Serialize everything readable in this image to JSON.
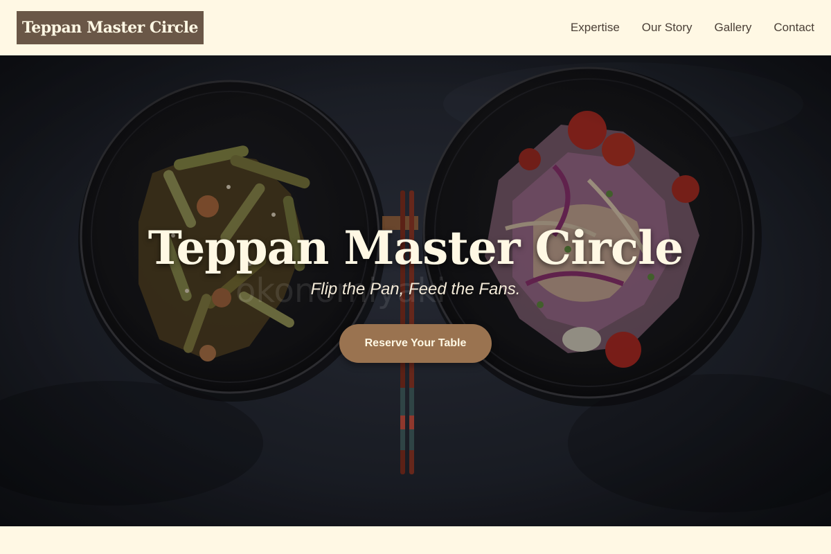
{
  "header": {
    "logo_text": "Teppan Master Circle",
    "nav": [
      {
        "label": "Expertise"
      },
      {
        "label": "Our Story"
      },
      {
        "label": "Gallery"
      },
      {
        "label": "Contact"
      }
    ]
  },
  "hero": {
    "title": "Teppan Master Circle",
    "tagline": "Flip the Pan, Feed the Fans.",
    "cta_label": "Reserve Your Table",
    "watermark_text": "okonomiyaki"
  },
  "colors": {
    "background": "#fff8e4",
    "logo_background": "#6a5747",
    "button": "#9a7350",
    "nav_text": "#4a3f36",
    "hero_text": "#fff8e4"
  }
}
